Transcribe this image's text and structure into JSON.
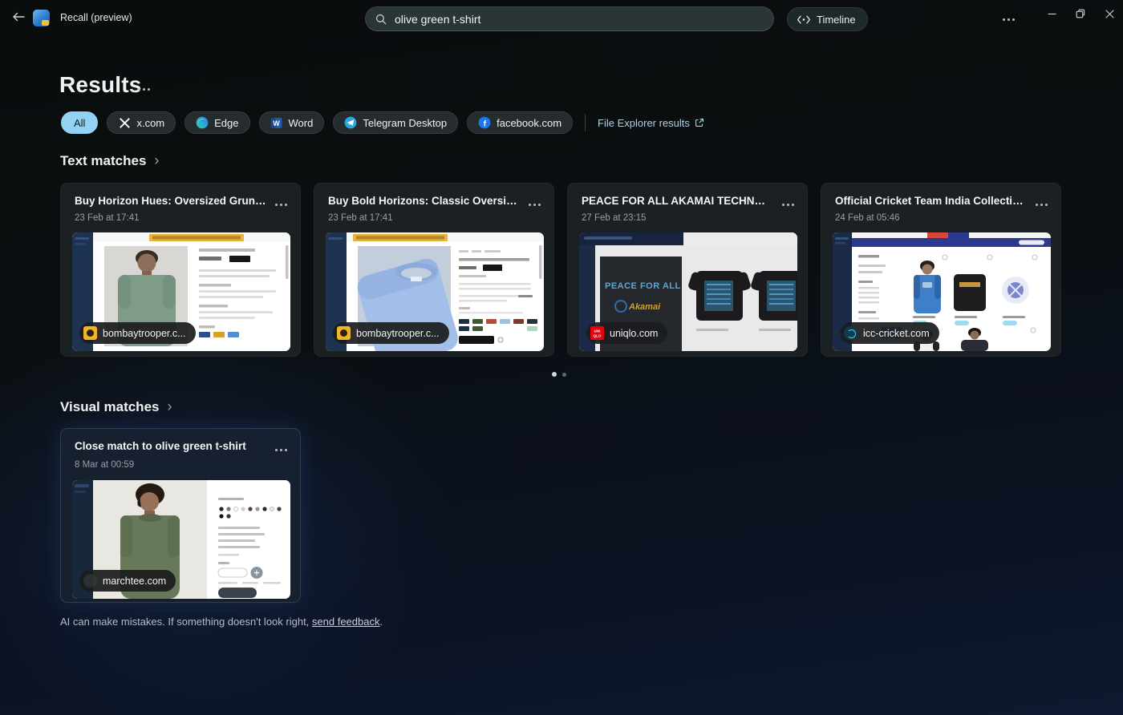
{
  "titlebar": {
    "app_title": "Recall (preview)",
    "search": {
      "value": "olive green t-shirt"
    },
    "timeline_label": "Timeline"
  },
  "results": {
    "heading": "Results",
    "filters": [
      {
        "label": "All",
        "selected": true
      },
      {
        "label": "x.com",
        "icon": "x-logo-icon"
      },
      {
        "label": "Edge",
        "icon": "edge-logo-icon"
      },
      {
        "label": "Word",
        "icon": "word-logo-icon"
      },
      {
        "label": "Telegram Desktop",
        "icon": "telegram-logo-icon"
      },
      {
        "label": "facebook.com",
        "icon": "facebook-logo-icon"
      }
    ],
    "file_explorer_link": "File Explorer results"
  },
  "text_matches": {
    "heading": "Text matches",
    "cards": [
      {
        "title": "Buy Horizon Hues: Oversized Grunge T-shi...",
        "date": "23 Feb at 17:41",
        "domain": "bombaytrooper.c..."
      },
      {
        "title": "Buy Bold Horizons: Classic Oversized T-shi...",
        "date": "23 Feb at 17:41",
        "domain": "bombaytrooper.c..."
      },
      {
        "title": "PEACE FOR ALL AKAMAI TECHNOLOGIES (...",
        "date": "27 Feb at 23:15",
        "domain": "uniqlo.com"
      },
      {
        "title": "Official Cricket Team India Collection | Jers...",
        "date": "24 Feb at 05:46",
        "domain": "icc-cricket.com"
      }
    ],
    "pagination": {
      "dot_count": 2,
      "active_index": 0
    }
  },
  "visual_matches": {
    "heading": "Visual matches",
    "cards": [
      {
        "title_prefix": "Close match to ",
        "title_emphasis": "olive green t-shirt",
        "date": "8 Mar at 00:59",
        "domain": "marchtee.com"
      }
    ]
  },
  "footer": {
    "text": "AI can make mistakes. If something doesn't look right, ",
    "link_label": "send feedback",
    "suffix": "."
  },
  "colors": {
    "accent_selected_chip": "#93d2f4",
    "link_blue": "#a8d4ec",
    "card_background": "#1b2022",
    "visual_card_background": "#16202f",
    "badge_background": "#1b1d1e"
  },
  "chevron_glyph": "›"
}
